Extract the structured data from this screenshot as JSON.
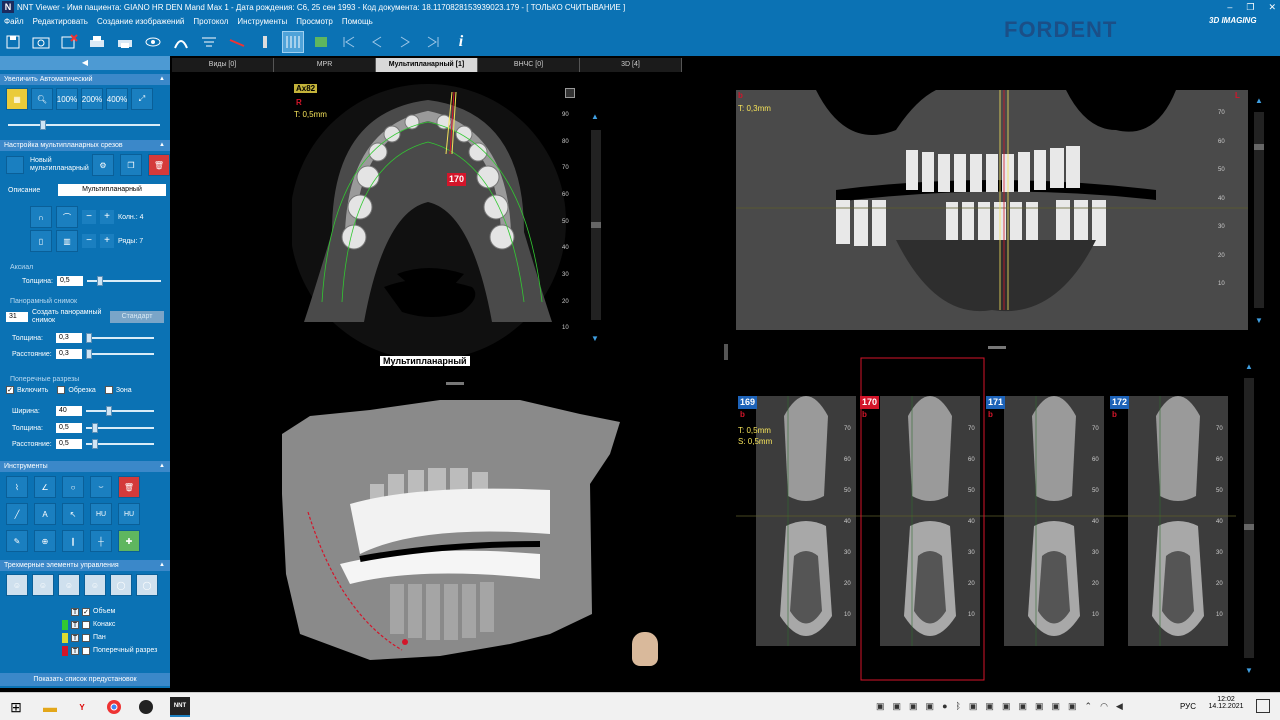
{
  "window": {
    "app_icon": "N",
    "title": "NNT Viewer - Имя пациента: GIANO HR DEN Mand Max 1 - Дата рождения: С6, 25 сен 1993 - Код документа: 18.1170828153939023.179  -  [ ТОЛЬКО СЧИТЫВАНИЕ ]",
    "controls": [
      "–",
      "❐",
      "✕"
    ]
  },
  "menu": [
    "Файл",
    "Редактировать",
    "Создание изображений",
    "Протокол",
    "Инструменты",
    "Просмотр",
    "Помощь"
  ],
  "brand": {
    "name": "FORDENT",
    "sub": "3D IMAGING",
    "color": "#1b4f87"
  },
  "left": {
    "collapse_label": "◀",
    "zoom_section": "Увеличить Автоматический",
    "zoom_buttons": [
      "100%",
      "200%",
      "400%"
    ],
    "mpr_section": "Настройка мультипланарных срезов",
    "new_mpr": "Новый мультипланарный",
    "desc_label": "Описание",
    "desc_value": "Мультипланарный",
    "cols_label": "Колн.: 4",
    "rows_label": "Ряды: 7",
    "axis_group": "Аксиал",
    "thickness_label": "Толщина:",
    "thickness_value": "0,5",
    "pan_group": "Панорамный снимок",
    "pan_select": "31",
    "create_pan": "Создать панорамный снимок",
    "std_button": "Стандарт",
    "pan_thick_value": "0,3",
    "distance_label": "Расстояние:",
    "pan_dist_value": "0,3",
    "cross_group": "Поперечные разрезы",
    "enabled_label": "Включить",
    "trim_label": "Обрезка",
    "zone_label": "Зона",
    "width_label": "Ширина:",
    "width_value": "40",
    "cross_thick_value": "0,5",
    "cross_dist_value": "0,5",
    "tools_section": "Инструменты",
    "tool_hu_1": "HU",
    "tool_hu_2": "HU",
    "controls3d_section": "Трехмерные элементы управления",
    "layers": [
      {
        "label": "Объем",
        "color": "#0b72b4",
        "checked": true
      },
      {
        "label": "Конакс",
        "color": "#32c832",
        "checked": false
      },
      {
        "label": "Пан",
        "color": "#dcdc32",
        "checked": false
      },
      {
        "label": "Поперечный разрез",
        "color": "#d4152a",
        "checked": false
      }
    ],
    "show_presets": "Показать список предустановок"
  },
  "tabs": [
    "Виды [0]",
    "MPR",
    "Мультипланарный [1]",
    "ВНЧС [0]",
    "3D [4]"
  ],
  "axial": {
    "label": "Ax82",
    "orient": "R",
    "thickness": "T: 0,5mm",
    "slice_badge": "170",
    "caption": "Мультипланарный",
    "ticks": [
      "90",
      "80",
      "70",
      "60",
      "50",
      "40",
      "30",
      "20",
      "10"
    ]
  },
  "panoramic": {
    "orient_l": "b",
    "orient_r": "L",
    "thickness": "T: 0,3mm",
    "ticks": [
      "70",
      "60",
      "50",
      "40",
      "30",
      "20",
      "10"
    ]
  },
  "cross": {
    "slices": [
      {
        "num": "169",
        "color": "blue"
      },
      {
        "num": "170",
        "color": "red"
      },
      {
        "num": "171",
        "color": "blue"
      },
      {
        "num": "172",
        "color": "blue"
      }
    ],
    "thickness": "T: 0,5mm",
    "spacing": "S: 0,5mm",
    "orient": "b",
    "ticks": [
      "70",
      "60",
      "50",
      "40",
      "30",
      "20",
      "10"
    ]
  },
  "taskbar": {
    "lang": "РУС",
    "time": "12:02",
    "date": "14.12.2021",
    "app": "NNT"
  }
}
